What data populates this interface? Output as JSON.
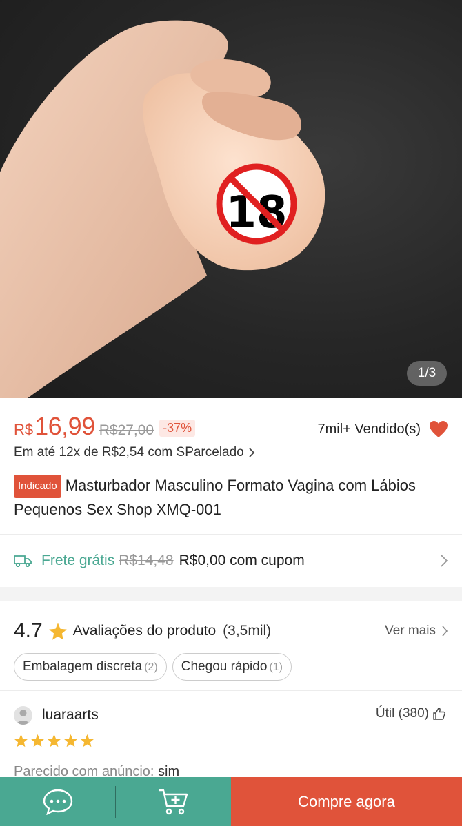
{
  "product_image": {
    "page_indicator": "1/3",
    "censor_label": "18",
    "total_images": 3,
    "current_image": 1
  },
  "price": {
    "currency": "R$",
    "current": "16,99",
    "original": "R$27,00",
    "discount": "-37%",
    "sold": "7mil+ Vendido(s)",
    "installment": "Em até 12x de R$2,54 com SParcelado"
  },
  "product": {
    "badge": "Indicado",
    "title": "Masturbador Masculino Formato Vagina com Lábios Pequenos Sex Shop XMQ-001"
  },
  "shipping": {
    "free_label": "Frete grátis",
    "old_price": "R$14,48",
    "coupon_text": "R$0,00 com cupom"
  },
  "reviews": {
    "rating": "4.7",
    "title": "Avaliações do produto",
    "count": "(3,5mil)",
    "see_more": "Ver mais",
    "tags": [
      {
        "label": "Embalagem discreta",
        "count": "(2)"
      },
      {
        "label": "Chegou rápido",
        "count": "(1)"
      }
    ],
    "first": {
      "user": "luaraarts",
      "useful": "Útil (380)",
      "stars": 5,
      "attr_label": "Parecido com anúncio:",
      "attr_value": "sim"
    }
  },
  "bottom_bar": {
    "buy_label": "Compre agora"
  },
  "colors": {
    "accent": "#e0533a",
    "secondary": "#4aa892",
    "star": "#f5b731"
  },
  "icons": [
    "chat-icon",
    "add-to-cart-icon",
    "heart-icon",
    "truck-icon",
    "star-icon",
    "thumbs-up-icon",
    "chevron-right-icon",
    "user-avatar-icon"
  ]
}
